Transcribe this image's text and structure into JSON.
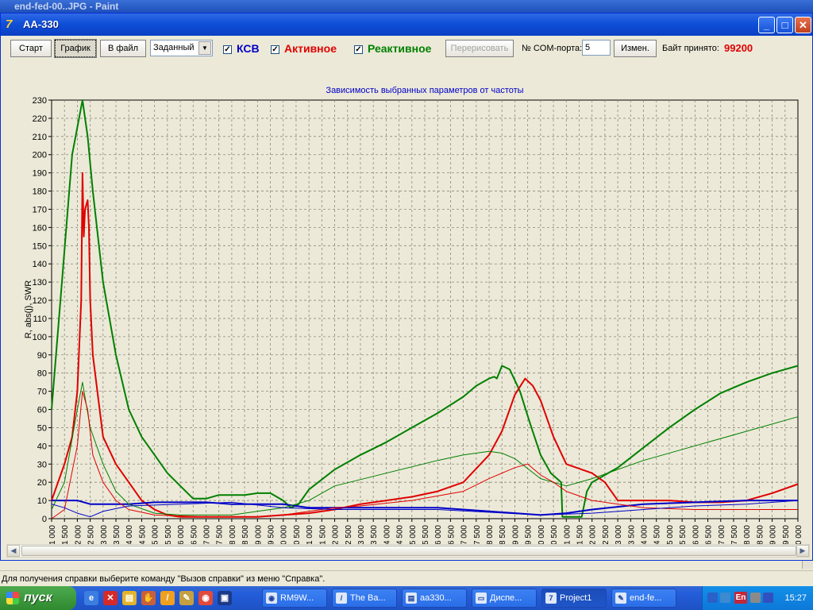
{
  "background_window": {
    "title": "end-fed-00..JPG - Paint"
  },
  "window": {
    "title": "AA-330",
    "minimize": "_",
    "maximize": "□",
    "close": "✕"
  },
  "toolbar": {
    "start_label": "Старт",
    "graph_label": "График",
    "to_file_label": "В файл",
    "mode_value": "Заданный",
    "swr_checked": "✓",
    "swr_label": "КСВ",
    "active_checked": "✓",
    "active_label": "Активное",
    "reactive_checked": "✓",
    "reactive_label": "Реактивное",
    "redraw_label": "Перерисовать",
    "com_label": "№ COM-порта:",
    "com_value": "5",
    "change_label": "Измен.",
    "bytes_label": "Байт принято:",
    "bytes_value": "99200",
    "colors": {
      "swr": "#0000c8",
      "active": "#e00000",
      "reactive": "#008000",
      "bytes": "#e00000"
    }
  },
  "chart_data": {
    "type": "line",
    "title": "Зависимость выбранных параметров от частоты",
    "ylabel": "R, abs(j), SWR",
    "xlabel": "",
    "xlim": [
      1000,
      30000
    ],
    "ylim": [
      0,
      230
    ],
    "x_ticks": [
      1000,
      1500,
      2000,
      2500,
      3000,
      3500,
      4000,
      4500,
      5000,
      5500,
      6000,
      6500,
      7000,
      7500,
      8000,
      8500,
      9000,
      9500,
      10000,
      10500,
      11000,
      11500,
      12000,
      12500,
      13000,
      13500,
      14000,
      14500,
      15000,
      15500,
      16000,
      16500,
      17000,
      17500,
      18000,
      18500,
      19000,
      19500,
      20000,
      20500,
      21000,
      21500,
      22000,
      22500,
      23000,
      23500,
      24000,
      24500,
      25000,
      25500,
      26000,
      26500,
      27000,
      27500,
      28000,
      28500,
      29000,
      29500,
      30000
    ],
    "x_tick_labels": [
      "1 000",
      "1 500",
      "2 000",
      "2 500",
      "3 000",
      "3 500",
      "4 000",
      "4 500",
      "5 000",
      "5 500",
      "6 000",
      "6 500",
      "7 000",
      "7 500",
      "8 000",
      "8 500",
      "9 000",
      "9 500",
      "10 000",
      "10 500",
      "11 000",
      "11 500",
      "12 000",
      "12 500",
      "13 000",
      "13 500",
      "14 000",
      "14 500",
      "15 000",
      "15 500",
      "16 000",
      "16 500",
      "17 000",
      "17 500",
      "18 000",
      "18 500",
      "19 000",
      "19 500",
      "20 000",
      "20 500",
      "21 000",
      "21 500",
      "22 000",
      "22 500",
      "23 000",
      "23 500",
      "24 000",
      "24 500",
      "25 000",
      "25 500",
      "26 000",
      "26 500",
      "27 000",
      "27 500",
      "28 000",
      "28 500",
      "29 000",
      "29 500",
      "30 000"
    ],
    "y_ticks": [
      0,
      10,
      20,
      30,
      40,
      50,
      60,
      70,
      80,
      90,
      100,
      110,
      120,
      130,
      140,
      150,
      160,
      170,
      180,
      190,
      200,
      210,
      220,
      230
    ],
    "grid": true,
    "series": [
      {
        "color": "#008000",
        "width": 2,
        "x": [
          1000,
          1400,
          1800,
          2200,
          2400,
          2600,
          3000,
          3500,
          4000,
          4500,
          5000,
          5500,
          6000,
          6500,
          7000,
          7500,
          8000,
          8500,
          9000,
          9500,
          10000,
          10300,
          10600,
          11000,
          12000,
          13000,
          14000,
          15000,
          16000,
          17000,
          17500,
          18000,
          18200,
          18300,
          18500,
          18800,
          19200,
          19600,
          20000,
          20400,
          20800,
          20850,
          21300,
          21600,
          21800,
          22000,
          23000,
          24000,
          25000,
          26000,
          27000,
          28000,
          29000,
          30000
        ],
        "y": [
          60,
          130,
          200,
          230,
          210,
          180,
          130,
          90,
          60,
          45,
          35,
          25,
          18,
          11,
          11,
          13,
          13,
          13,
          14,
          14,
          10,
          6,
          8,
          16,
          27,
          35,
          42,
          50,
          58,
          67,
          73,
          77,
          78,
          77,
          84,
          82,
          70,
          52,
          35,
          25,
          20,
          1,
          1,
          1,
          15,
          20,
          28,
          39,
          50,
          60,
          69,
          75,
          80,
          84
        ]
      },
      {
        "color": "#e00000",
        "width": 2,
        "x": [
          1000,
          1500,
          1800,
          2000,
          2150,
          2200,
          2250,
          2300,
          2400,
          2450,
          2500,
          2600,
          3000,
          3500,
          4000,
          4500,
          5000,
          5500,
          6000,
          7000,
          8000,
          9000,
          10000,
          11000,
          12000,
          13000,
          14000,
          15000,
          16000,
          17000,
          18000,
          18500,
          19000,
          19400,
          19700,
          20000,
          20500,
          21000,
          22000,
          22500,
          23000,
          24000,
          25000,
          26000,
          27000,
          28000,
          29000,
          30000
        ],
        "y": [
          10,
          30,
          45,
          70,
          120,
          190,
          155,
          170,
          175,
          160,
          120,
          90,
          45,
          30,
          20,
          10,
          5,
          2,
          1,
          1,
          1,
          1,
          2,
          3,
          5,
          8,
          10,
          12,
          15,
          20,
          35,
          48,
          68,
          77,
          73,
          65,
          45,
          30,
          25,
          20,
          10,
          10,
          10,
          9,
          9,
          10,
          14,
          19
        ]
      },
      {
        "color": "#0000c8",
        "width": 2,
        "x": [
          1000,
          1500,
          2000,
          2500,
          3000,
          4000,
          5000,
          6000,
          7000,
          8000,
          9000,
          10000,
          11000,
          12000,
          14000,
          16000,
          18000,
          20000,
          21000,
          22000,
          24000,
          26000,
          28000,
          30000
        ],
        "y": [
          10,
          10,
          10,
          8,
          8,
          8,
          9,
          9,
          9,
          8,
          8,
          8,
          6,
          6,
          6,
          6,
          4,
          2,
          3,
          5,
          8,
          9,
          10,
          10
        ]
      },
      {
        "color": "#008000",
        "width": 1,
        "x": [
          1000,
          1500,
          2000,
          2200,
          2500,
          3000,
          3500,
          4000,
          5000,
          6000,
          8000,
          9000,
          10000,
          11000,
          12000,
          14000,
          16000,
          17000,
          18000,
          18500,
          19000,
          20000,
          20500,
          21000,
          22000,
          24000,
          26000,
          28000,
          30000
        ],
        "y": [
          5,
          20,
          60,
          75,
          50,
          30,
          15,
          8,
          3,
          2,
          2,
          4,
          6,
          10,
          18,
          25,
          32,
          35,
          37,
          36,
          33,
          22,
          20,
          18,
          22,
          32,
          40,
          48,
          56
        ]
      },
      {
        "color": "#e00000",
        "width": 1,
        "x": [
          1000,
          1500,
          2000,
          2200,
          2400,
          2600,
          3000,
          3500,
          4000,
          5000,
          7000,
          9000,
          10000,
          11000,
          12000,
          13000,
          15000,
          17000,
          18000,
          19000,
          19500,
          20000,
          20500,
          21000,
          22000,
          24000,
          26000,
          28000,
          30000
        ],
        "y": [
          0,
          5,
          40,
          70,
          60,
          35,
          20,
          10,
          5,
          2,
          1,
          1,
          2,
          4,
          6,
          7,
          10,
          15,
          22,
          28,
          30,
          24,
          20,
          15,
          10,
          6,
          5,
          5,
          5
        ]
      },
      {
        "color": "#0000c8",
        "width": 1,
        "x": [
          1000,
          1500,
          2000,
          2500,
          3000,
          4000,
          6000,
          8000,
          10000,
          12000,
          16000,
          20000,
          22000,
          24000,
          26000,
          28000,
          30000
        ],
        "y": [
          8,
          6,
          3,
          1,
          4,
          7,
          8,
          9,
          6,
          5,
          5,
          2,
          3,
          5,
          7,
          8,
          10
        ]
      }
    ]
  },
  "status_bar": {
    "text": "Для получения справки выберите команду \"Вызов справки\" из меню \"Справка\"."
  },
  "taskbar": {
    "start_label": "пуск",
    "tasks": [
      "RM9W...",
      "The Ba...",
      "aa330...",
      "Диспе...",
      "Project1",
      "end-fe..."
    ],
    "lang": "En",
    "clock": "15:27"
  }
}
